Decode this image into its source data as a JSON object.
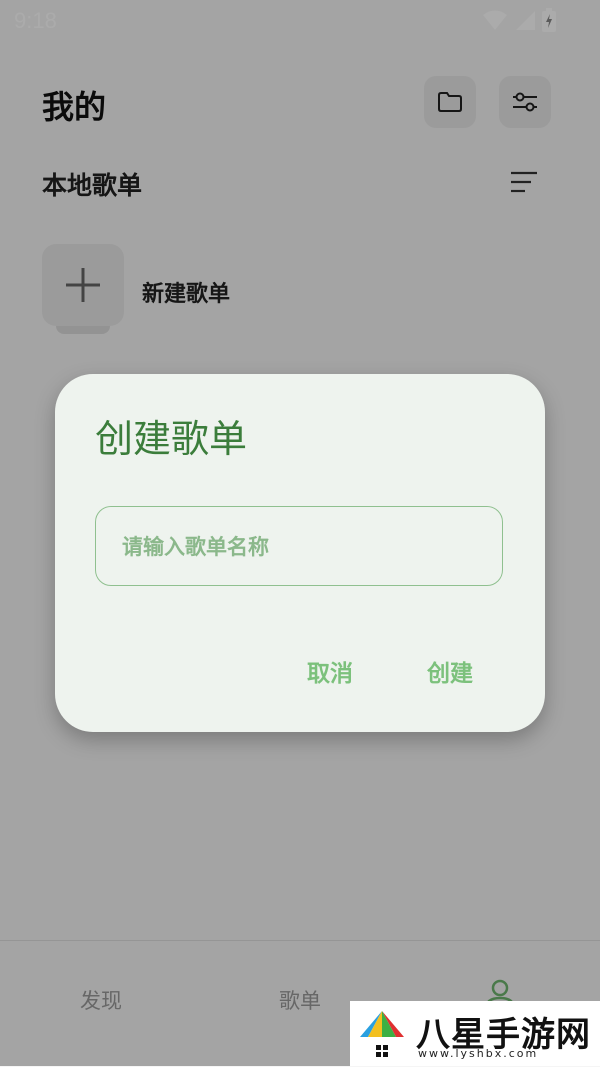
{
  "status_bar": {
    "time": "9:18"
  },
  "header": {
    "title": "我的",
    "folder_icon": "folder-icon",
    "filter_icon": "filter-sliders-icon"
  },
  "section": {
    "title": "本地歌单",
    "sort_icon": "sort-lines-icon"
  },
  "new_playlist": {
    "label": "新建歌单",
    "icon": "plus-icon"
  },
  "dialog": {
    "title": "创建歌单",
    "input_placeholder": "请输入歌单名称",
    "input_value": "",
    "cancel_label": "取消",
    "create_label": "创建",
    "accent_color": "#3b7d3b"
  },
  "bottom_nav": {
    "items": [
      {
        "label": "发现"
      },
      {
        "label": "歌单"
      },
      {
        "label": "",
        "icon": "user-icon"
      }
    ]
  },
  "watermark": {
    "brand": "八星手游网",
    "url": "www.lyshbx.com"
  }
}
